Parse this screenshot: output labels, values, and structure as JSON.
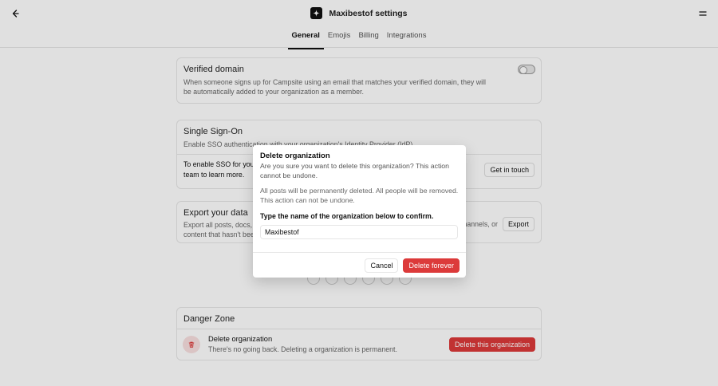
{
  "header": {
    "title": "Maxibestof settings",
    "tabs": [
      {
        "label": "General",
        "active": true
      },
      {
        "label": "Emojis",
        "active": false
      },
      {
        "label": "Billing",
        "active": false
      },
      {
        "label": "Integrations",
        "active": false
      }
    ]
  },
  "verified_domain": {
    "title": "Verified domain",
    "description": "When someone signs up for Campsite using an email that matches your verified domain, they will be automatically added to your organization as a member.",
    "toggle_on": false
  },
  "sso": {
    "title": "Single Sign-On",
    "description": "Enable SSO authentication with your organization's Identity Provider (IdP).",
    "row_text": "To enable SSO for your",
    "row_text2": "team to learn more.",
    "button": "Get in touch"
  },
  "export": {
    "title": "Export your data",
    "description": "Export all posts, docs,",
    "description2": "content that hasn't bee",
    "description_tail": "hannels, or",
    "button": "Export"
  },
  "danger_zone": {
    "title": "Danger Zone",
    "item_title": "Delete organization",
    "item_desc": "There's no going back. Deleting a organization is permanent.",
    "button": "Delete this organization"
  },
  "modal": {
    "title": "Delete organization",
    "text": "Are you sure you want to delete this organization? This action cannot be undone.",
    "text2": "All posts will be permanently deleted. All people will be removed. This action can not be undone.",
    "label": "Type the name of the organization below to confirm.",
    "input_value": "Maxibestof",
    "cancel": "Cancel",
    "confirm": "Delete forever"
  },
  "colors": {
    "danger": "#dc3a3a",
    "text": "#1f1f1f",
    "muted": "#666666",
    "border": "#e6e6e6"
  }
}
